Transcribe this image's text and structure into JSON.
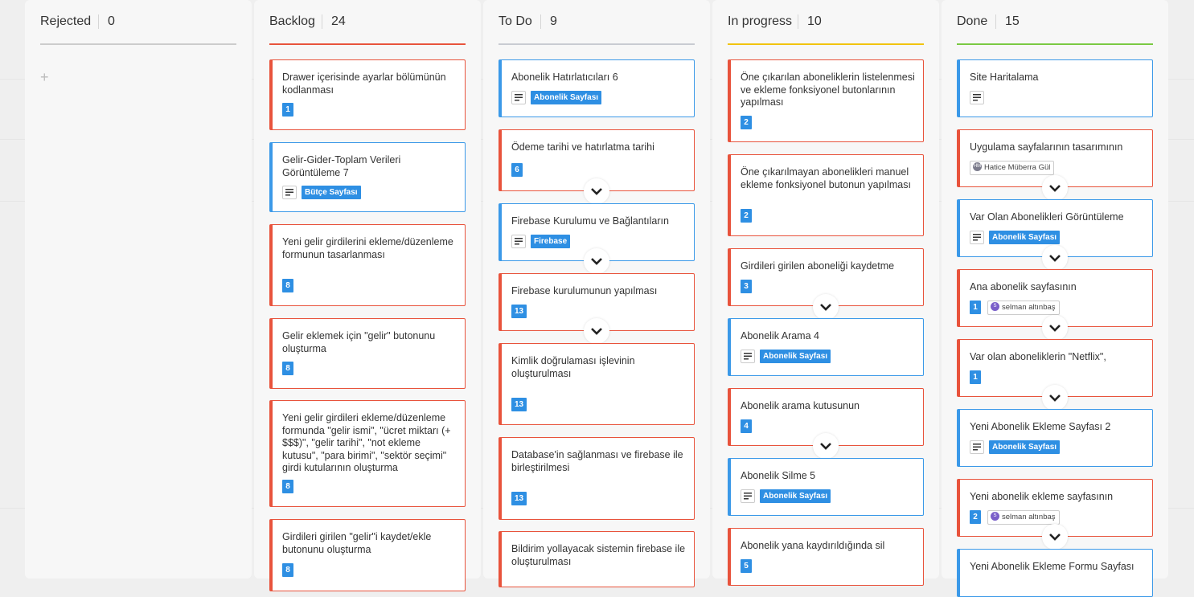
{
  "board": {
    "columns": [
      {
        "id": "rejected",
        "title": "Rejected",
        "count": "0",
        "accent": "#cccccc",
        "add_symbol": "+"
      },
      {
        "id": "backlog",
        "title": "Backlog",
        "count": "24",
        "accent": "#e8533c"
      },
      {
        "id": "todo",
        "title": "To Do",
        "count": "9",
        "accent": "#c8cbd2"
      },
      {
        "id": "inprogress",
        "title": "In progress",
        "count": "10",
        "accent": "#f1c40f"
      },
      {
        "id": "done",
        "title": "Done",
        "count": "15",
        "accent": "#7ac943"
      }
    ],
    "backlog_cards": [
      {
        "title": "Drawer içerisinde ayarlar bölümünün kodlanması",
        "points": "1"
      },
      {
        "title": "Gelir-Gider-Toplam Verileri Görüntüleme 7",
        "tag": "Bütçe Sayfası",
        "icon": "description-icon"
      },
      {
        "title": "Yeni gelir girdilerini ekleme/düzenleme formunun tasarlanması",
        "points": "8"
      },
      {
        "title": "Gelir eklemek için \"gelir\" butonunu oluşturma",
        "points": "8"
      },
      {
        "title": "Yeni gelir girdileri ekleme/düzenleme formunda \"gelir ismi\", \"ücret miktarı (+ $$$)\", \"gelir tarihi\", \"not ekleme kutusu\", \"para birimi\", \"sektör seçimi\" girdi kutularının oluşturma",
        "points": "8"
      },
      {
        "title": "Girdileri girilen \"gelir\"i kaydet/ekle butonunu oluşturma",
        "points": "8"
      }
    ],
    "todo_cards": [
      {
        "title": "Abonelik Hatırlatıcıları 6",
        "tag": "Abonelik Sayfası",
        "icon": "description-icon"
      },
      {
        "title": "Ödeme tarihi ve hatırlatma tarihi",
        "points": "6"
      },
      {
        "title": "Firebase Kurulumu ve Bağlantıların",
        "tag": "Firebase",
        "icon": "description-icon"
      },
      {
        "title": "Firebase kurulumunun yapılması",
        "points": "13"
      },
      {
        "title": "Kimlik doğrulaması işlevinin oluşturulması",
        "points": "13"
      },
      {
        "title": "Database'in sağlanması ve firebase ile birleştirilmesi",
        "points": "13"
      },
      {
        "title": "Bildirim yollayacak sistemin firebase ile oluşturulması"
      }
    ],
    "inprogress_cards": [
      {
        "title": "Öne çıkarılan aboneliklerin listelenmesi ve ekleme fonksiyonel butonlarının yapılması",
        "points": "2"
      },
      {
        "title": "Öne çıkarılmayan abonelikleri manuel ekleme fonksiyonel butonun yapılması",
        "points": "2"
      },
      {
        "title": "Girdileri girilen aboneliği kaydetme",
        "points": "3"
      },
      {
        "title": "Abonelik Arama 4",
        "tag": "Abonelik Sayfası",
        "icon": "description-icon"
      },
      {
        "title": "Abonelik arama kutusunun",
        "points": "4"
      },
      {
        "title": "Abonelik Silme 5",
        "tag": "Abonelik Sayfası",
        "icon": "description-icon"
      },
      {
        "title": "Abonelik yana kaydırıldığında sil",
        "points": "5"
      }
    ],
    "done_cards": [
      {
        "title": "Site Haritalama",
        "icon": "description-icon"
      },
      {
        "title": "Uygulama sayfalarının tasarımının",
        "assignee": "Hatice Müberra Gül",
        "initials": "HM"
      },
      {
        "title": "Var Olan Abonelikleri Görüntüleme",
        "tag": "Abonelik Sayfası",
        "icon": "description-icon"
      },
      {
        "title": "Ana abonelik sayfasının",
        "points": "1",
        "assignee": "selman altınbaş",
        "initials": "S"
      },
      {
        "title": "Var olan aboneliklerin \"Netflix\",",
        "points": "1"
      },
      {
        "title": "Yeni Abonelik Ekleme Sayfası 2",
        "tag": "Abonelik Sayfası",
        "icon": "description-icon"
      },
      {
        "title": "Yeni abonelik ekleme sayfasının",
        "points": "2",
        "assignee": "selman altınbaş",
        "initials": "S"
      },
      {
        "title": "Yeni Abonelik Ekleme Formu Sayfası"
      }
    ],
    "expand_icon": "chevron-down-icon"
  }
}
